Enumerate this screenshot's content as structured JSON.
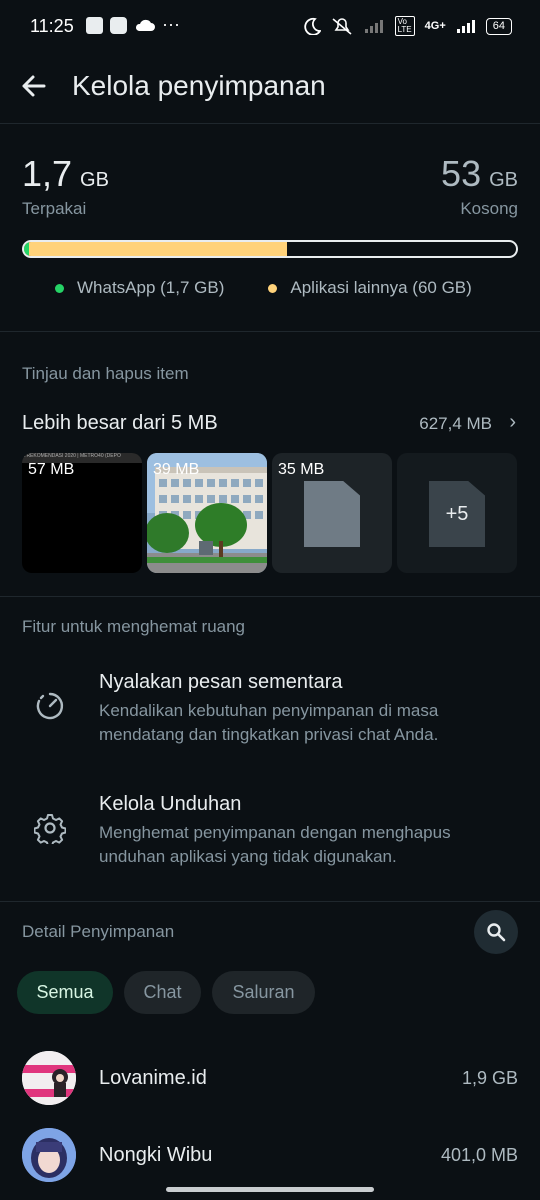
{
  "status_bar": {
    "time": "11:25",
    "battery": "64",
    "network": "4G+"
  },
  "header": {
    "title": "Kelola penyimpanan"
  },
  "storage": {
    "used_value": "1,7",
    "used_unit": "GB",
    "used_label": "Terpakai",
    "free_value": "53",
    "free_unit": "GB",
    "free_label": "Kosong",
    "used_fraction": 0.535,
    "whatsapp_fraction": 0.003,
    "legend": [
      {
        "label": "WhatsApp (1,7 GB)",
        "color": "#25d366"
      },
      {
        "label": "Aplikasi lainnya (60 GB)",
        "color": "#ffd27a"
      }
    ]
  },
  "review": {
    "section_title": "Tinjau dan hapus item",
    "row_title": "Lebih besar dari 5 MB",
    "row_size": "627,4 MB",
    "thumbs": [
      {
        "label": "57 MB",
        "kind": "video"
      },
      {
        "label": "39 MB",
        "kind": "image"
      },
      {
        "label": "35 MB",
        "kind": "document"
      },
      {
        "label": "+5",
        "kind": "more"
      }
    ]
  },
  "features": {
    "section_title": "Fitur untuk menghemat ruang",
    "items": [
      {
        "title": "Nyalakan pesan sementara",
        "desc": "Kendalikan kebutuhan penyimpanan di masa mendatang dan tingkatkan privasi chat Anda.",
        "icon": "timer-icon"
      },
      {
        "title": "Kelola Unduhan",
        "desc": "Menghemat penyimpanan dengan menghapus unduhan aplikasi yang tidak digunakan.",
        "icon": "gear-icon"
      }
    ]
  },
  "details": {
    "section_title": "Detail Penyimpanan",
    "chips": [
      "Semua",
      "Chat",
      "Saluran"
    ],
    "list": [
      {
        "name": "Lovanime.id",
        "size": "1,9 GB"
      },
      {
        "name": "Nongki Wibu",
        "size": "401,0 MB"
      }
    ]
  },
  "colors": {
    "accent": "#25d366",
    "other_apps": "#ffd27a",
    "background": "#0b1014"
  }
}
